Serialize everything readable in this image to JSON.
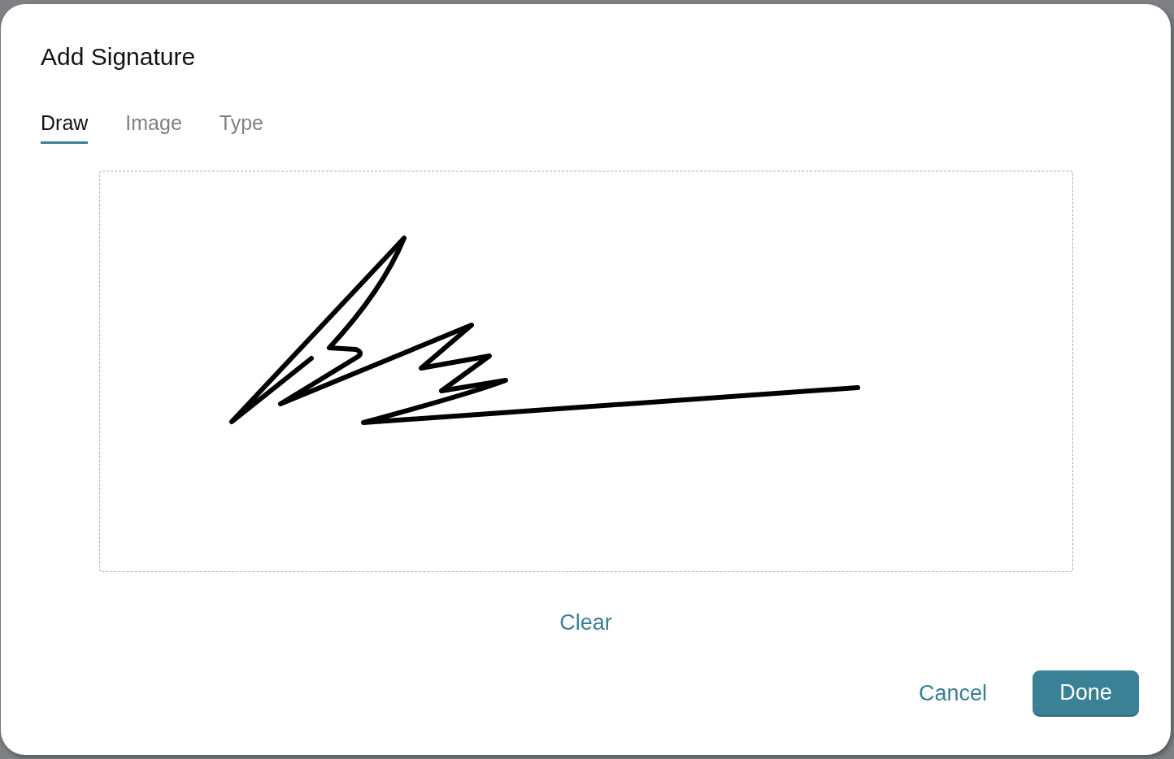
{
  "dialog": {
    "title": "Add Signature",
    "tabs": [
      {
        "label": "Draw",
        "selected": true
      },
      {
        "label": "Image",
        "selected": false
      },
      {
        "label": "Type",
        "selected": false
      }
    ],
    "clear_button": "Clear",
    "buttons": [
      {
        "label": "Cancel",
        "kind": "secondary"
      },
      {
        "label": "Done",
        "kind": "primary"
      }
    ]
  }
}
